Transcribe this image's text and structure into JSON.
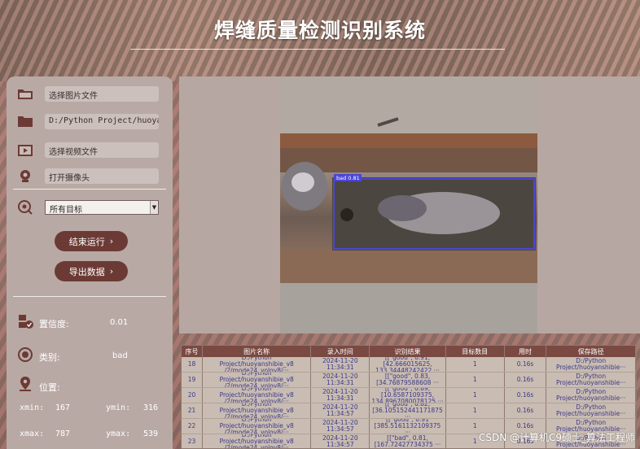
{
  "app": {
    "title": "焊缝质量检测识别系统"
  },
  "sidebar": {
    "image_file_label": "选择图片文件",
    "folder_path": "D:/Python Project/huoyanshi",
    "video_file_label": "选择视频文件",
    "camera_label": "打开摄像头",
    "target_select": {
      "selected": "所有目标"
    },
    "run_button": "结束运行",
    "export_button": "导出数据",
    "confidence_label": "置信度:",
    "confidence_value": "0.01",
    "class_label": "类别:",
    "class_value": "bad",
    "position_label": "位置:",
    "xmin_label": "xmin:",
    "xmin_value": "167",
    "ymin_label": "ymin:",
    "ymin_value": "316",
    "xmax_label": "xmax:",
    "xmax_value": "787",
    "ymax_label": "ymax:",
    "ymax_value": "539"
  },
  "detection": {
    "box_label": "bad 0.81",
    "box_color": "#4b46d6"
  },
  "table": {
    "headers": [
      "序号",
      "图片名称",
      "录入时间",
      "识别结果",
      "目标数目",
      "用时",
      "保存路径"
    ],
    "rows": [
      [
        "18",
        "D:/Python Project/huoyanshibie_v8\n/2/mode24_yolov8/···",
        "2024-11-20\n11:34:31",
        "[[\"good\", 0.91, [42.666015625,\n133.34448242422 ···",
        "1",
        "0.16s",
        "D:/Python\nProject/huoyanshibie···"
      ],
      [
        "19",
        "D:/Python Project/huoyanshibie_v8\n/2/mode24_yolov8/···",
        "2024-11-20\n11:34:31",
        "[[\"good\", 0.83,\n[34.76879588608 ···",
        "1",
        "0.16s",
        "D:/Python\nProject/huoyanshibie···"
      ],
      [
        "20",
        "D:/Python Project/huoyanshibie_v8\n/2/mode24_yolov8/···",
        "2024-11-20\n11:34:31",
        "[[\"good\", 0.89, [10.6587109375,\n134.8967080078125 ···",
        "1",
        "0.16s",
        "D:/Python\nProject/huoyanshibie···"
      ],
      [
        "21",
        "D:/Python Project/huoyanshibie_v8\n/2/mode24_yolov8/···",
        "2024-11-20\n11:34:57",
        "[[\"good\", 0.82,\n[36.105152441171875 ···",
        "1",
        "0.16s",
        "D:/Python\nProject/huoyanshibie···"
      ],
      [
        "22",
        "D:/Python Project/huoyanshibie_v8\n/2/mode24_yolov8/···",
        "2024-11-20\n11:34:57",
        "[[\"good\", 0.91\n[385.5161132109375 ···",
        "1",
        "0.16s",
        "D:/Python\nProject/huoyanshibie···"
      ],
      [
        "23",
        "D:/Python Project/huoyanshibie_v8\n/2/mode24_yolov8/···",
        "2024-11-20\n11:34:57",
        "[[\"bad\", 0.81,\n[167.72427734375 ···",
        "1",
        "0.16s",
        "D:/Python\nProject/huoyanshibie···"
      ]
    ]
  },
  "watermark": "CSDN @计算机C9硕士_算法工程师"
}
